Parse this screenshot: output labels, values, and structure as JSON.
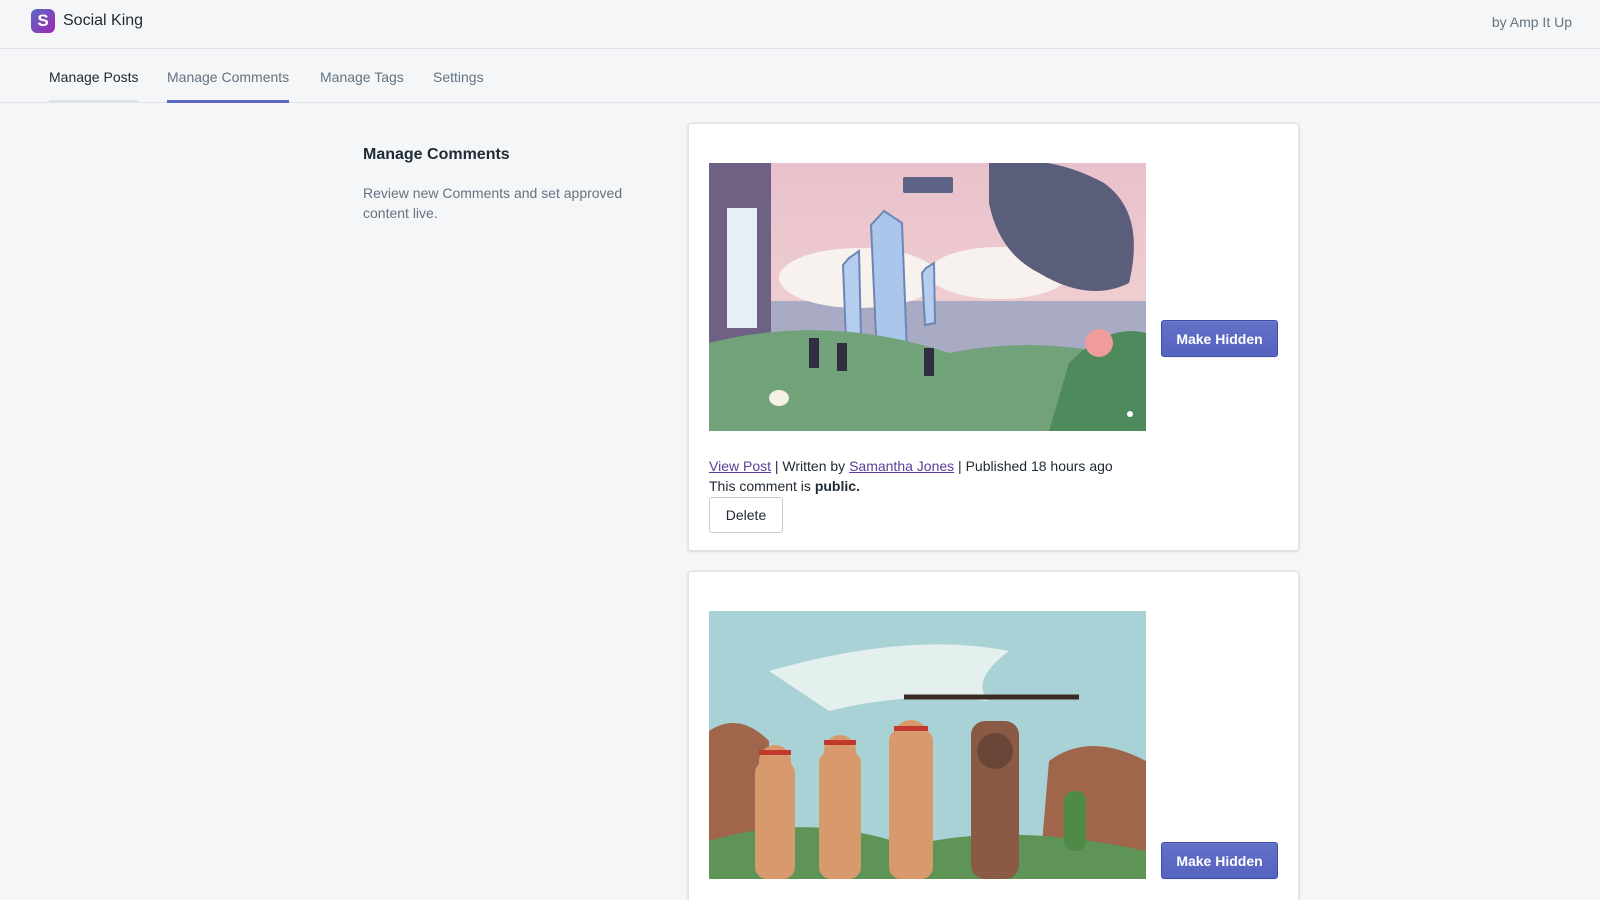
{
  "app": {
    "logo_letter": "S",
    "title": "Social King",
    "byline": "by Amp It Up"
  },
  "tabs": [
    {
      "label": "Manage Posts"
    },
    {
      "label": "Manage Comments"
    },
    {
      "label": "Manage Tags"
    },
    {
      "label": "Settings"
    }
  ],
  "section": {
    "title": "Manage Comments",
    "description": "Review new Comments and set approved content live."
  },
  "comments": [
    {
      "view_post_label": "View Post",
      "written_by_prefix": " | Written by ",
      "author": "Samantha Jones",
      "published": " | Published 18 hours ago",
      "status_prefix": "This comment is ",
      "status": "public.",
      "toggle_label": "Make Hidden",
      "delete_label": "Delete"
    },
    {
      "toggle_label": "Make Hidden"
    }
  ],
  "colors": {
    "accent": "#5c6ac4",
    "background": "#f4f6f8",
    "link": "#5c3d99"
  }
}
